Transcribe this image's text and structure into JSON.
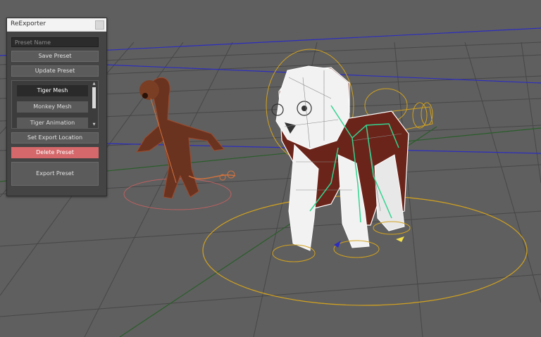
{
  "window": {
    "title": "ReExporter"
  },
  "form": {
    "preset_name_placeholder": "Preset Name",
    "save_label": "Save Preset",
    "update_label": "Update Preset",
    "preset_items": [
      {
        "label": "Tiger Mesh",
        "selected": true
      },
      {
        "label": "Monkey Mesh",
        "selected": false
      },
      {
        "label": "Tiger Animation",
        "selected": false
      }
    ],
    "set_export_location_label": "Set Export Location",
    "delete_label": "Delete Preset",
    "export_label": "Export Preset"
  },
  "colors": {
    "viewport_bg": "#5f5f5f",
    "grid_line": "#474747",
    "grid_axis_x": "#2a5d2a",
    "grid_axis_z": "#2d2dbf",
    "delete_button": "#d4686a",
    "rig_gold": "#d2a21e",
    "rig_green": "#33d490",
    "monkey_fur": "#6a3320"
  },
  "viewport": {
    "objects": [
      "monkey-model",
      "tiger-model"
    ]
  },
  "icons": {
    "close": "close-icon",
    "scroll_up": "scroll-up-icon",
    "scroll_down": "scroll-down-icon"
  }
}
